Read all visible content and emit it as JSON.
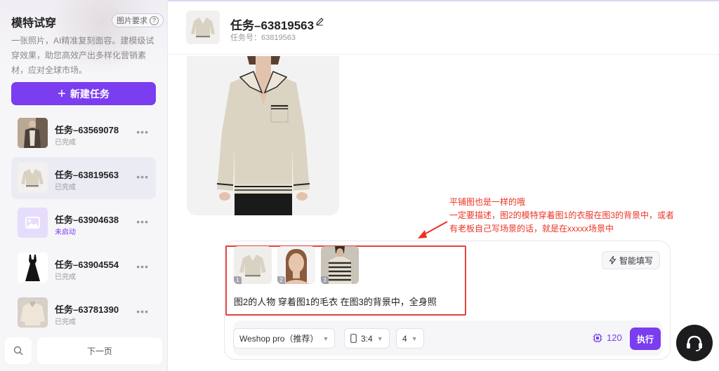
{
  "sidebar": {
    "title": "模特试穿",
    "image_req_label": "图片要求",
    "image_req_icon": "question-circle-icon",
    "description": "一张照片，AI精准复刻面容。建模级试穿效果，助您高效产出多样化营销素材，应对全球市场。",
    "new_task_label": "新建任务",
    "tasks": [
      {
        "name": "任务–63569078",
        "status": "已完成",
        "thumb": "model-in-coat"
      },
      {
        "name": "任务–63819563",
        "status": "已完成",
        "thumb": "sweater-flat",
        "active": true
      },
      {
        "name": "任务–63904638",
        "status": "未启动",
        "thumb": "image-placeholder-icon"
      },
      {
        "name": "任务–63904554",
        "status": "已完成",
        "thumb": "black-dress"
      },
      {
        "name": "任务–63781390",
        "status": "已完成",
        "thumb": "beige-jacket"
      }
    ],
    "more_glyph": "•••",
    "next_page_label": "下一页"
  },
  "header": {
    "title": "任务–63819563",
    "subtitle": "任务号：63819563"
  },
  "annotation": {
    "line1": "平铺图也是一样的哦",
    "line2": "一定要描述，图2的模特穿着图1的衣服在图3的背景中，或者",
    "line3": "有老板自己写场景的话，就是在xxxxx场景中",
    "color": "#ea3323"
  },
  "composer": {
    "ref_images": [
      {
        "num": "1",
        "label": "sweater-flat"
      },
      {
        "num": "2",
        "label": "model-face"
      },
      {
        "num": "3",
        "label": "striped-background"
      }
    ],
    "prompt_text": "图2的人物 穿着图1的毛衣 在图3的背景中，全身照",
    "smart_fill_label": "智能填写",
    "model_select": "Weshop pro（推荐）",
    "ratio_select": "3:4",
    "count_select": "4",
    "credits": "120",
    "run_label": "执行"
  },
  "colors": {
    "accent": "#7a3df0",
    "annotation_red": "#ea3323"
  }
}
